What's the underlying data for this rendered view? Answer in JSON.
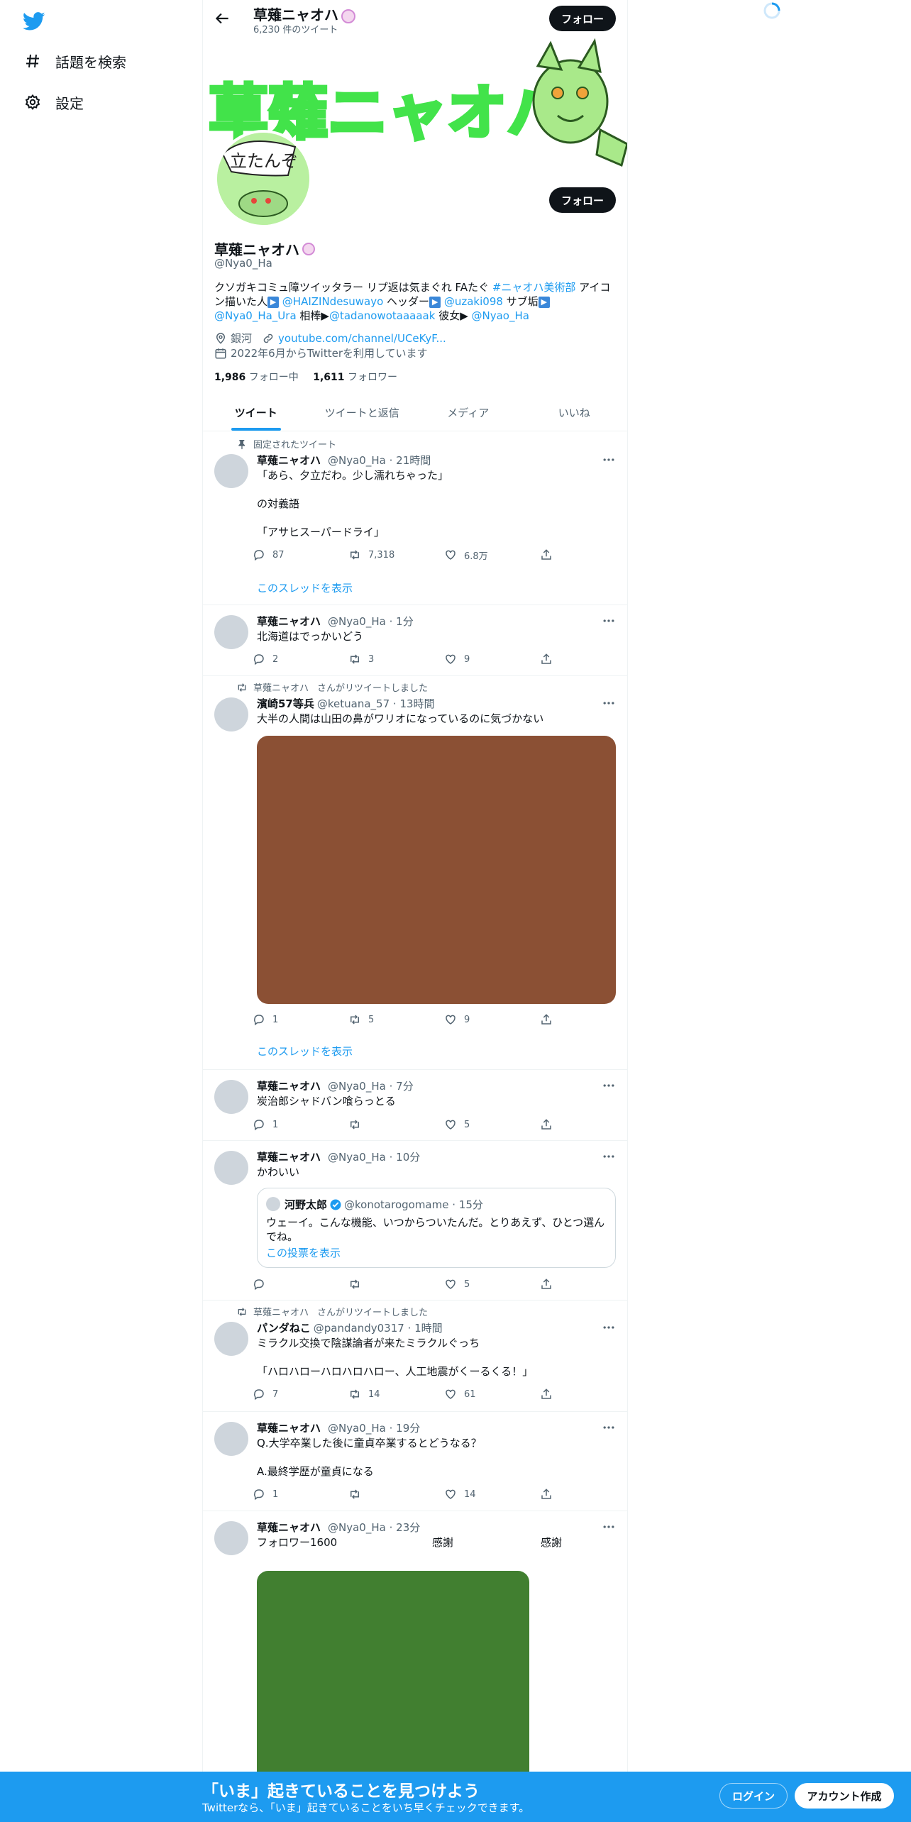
{
  "sidebar": {
    "items": [
      {
        "label": "話題を検索",
        "icon": "hashtag-icon"
      },
      {
        "label": "設定",
        "icon": "gear-icon"
      }
    ]
  },
  "header": {
    "name": "草薙ニャオハ",
    "tweet_count": "6,230 件のツイート",
    "follow_label": "フォロー"
  },
  "banner": {
    "title_art": "草薙ニャオハ",
    "avatar_caption": "立たんぞ"
  },
  "profile": {
    "name": "草薙ニャオハ",
    "handle": "@Nya0_Ha",
    "follow_label": "フォロー",
    "bio_1": "クソガキコミュ障ツイッタラー リプ返は気まぐれ FAたぐ ",
    "bio_tag": "#ニャオハ美術部",
    "bio_2": " アイコン描いた人",
    "bio_m1": "@HAIZINdesuwayo",
    "bio_3": " ヘッダー",
    "bio_m2": "@uzaki098",
    "bio_4": " サブ垢",
    "bio_m3": "@Nya0_Ha_Ura",
    "bio_5": " 相棒▶",
    "bio_m4": "@tadanowotaaaaak",
    "bio_6": " 彼女▶ ",
    "bio_m5": "@Nyao_Ha",
    "location": "銀河",
    "link": "youtube.com/channel/UCeKyF...",
    "joined": "2022年6月からTwitterを利用しています",
    "following_count": "1,986",
    "following_label": "フォロー中",
    "followers_count": "1,611",
    "followers_label": "フォロワー"
  },
  "tabs": [
    "ツイート",
    "ツイートと返信",
    "メディア",
    "いいね"
  ],
  "tweets": [
    {
      "context": "固定されたツイート",
      "name": "草薙ニャオハ",
      "handle": "@Nya0_Ha",
      "time": "· 21時間",
      "text": "「あら、夕立だわ。少し濡れちゃった」\n\nの対義語\n\n「アサヒスーパードライ」",
      "replies": "87",
      "retweets": "7,318",
      "likes": "6.8万",
      "show_thread": "このスレッドを表示"
    },
    {
      "name": "草薙ニャオハ",
      "handle": "@Nya0_Ha",
      "time": "· 1分",
      "text": "北海道はでっかいどう",
      "replies": "2",
      "retweets": "3",
      "likes": "9"
    },
    {
      "context": "草薙ニャオハ",
      "context_suffix": "さんがリツイートしました",
      "name": "濱崎57等兵",
      "handle": "@ketuana_57",
      "time": "· 13時間",
      "text": "大半の人間は山田の鼻がワリオになっているのに気づかない",
      "media_color": "#8b5034",
      "replies": "1",
      "retweets": "5",
      "likes": "9",
      "show_thread": "このスレッドを表示"
    },
    {
      "name": "草薙ニャオハ",
      "handle": "@Nya0_Ha",
      "time": "· 7分",
      "text": "炭治郎シャドバン喰らっとる",
      "replies": "1",
      "retweets": "",
      "likes": "5"
    },
    {
      "name": "草薙ニャオハ",
      "handle": "@Nya0_Ha",
      "time": "· 10分",
      "text": "かわいい",
      "quote": {
        "name": "河野太郎",
        "handle": "@konotarogomame",
        "time": "· 15分",
        "text": "ウェーイ。こんな機能、いつからついたんだ。とりあえず、ひとつ選んでね。",
        "poll_link": "この投票を表示"
      },
      "replies": "",
      "retweets": "",
      "likes": "5"
    },
    {
      "context": "草薙ニャオハ",
      "context_suffix": "さんがリツイートしました",
      "name": "パンダねこ",
      "handle": "@pandandy0317",
      "time": "· 1時間",
      "text": "ミラクル交換で陰謀論者が来たミラクルぐっち\n\n「ハロハローハロハロハロー、人工地震がくーるくる！」",
      "replies": "7",
      "retweets": "14",
      "likes": "61"
    },
    {
      "name": "草薙ニャオハ",
      "handle": "@Nya0_Ha",
      "time": "· 19分",
      "text": "Q.大学卒業した後に童貞卒業するとどうなる？\n\nA.最終学歴が童貞になる",
      "replies": "1",
      "retweets": "",
      "likes": "14"
    },
    {
      "name": "草薙ニャオハ",
      "handle": "@Nya0_Ha",
      "time": "· 23分",
      "text": "フォロワー1600",
      "text_2": "感謝",
      "text_3": "感謝",
      "media_color": "#417f30"
    }
  ],
  "bottom_bar": {
    "title": "「いま」起きていることを見つけよう",
    "subtitle": "Twitterなら、「いま」起きていることをいち早くチェックできます。",
    "login": "ログイン",
    "signup": "アカウント作成"
  },
  "colors": {
    "accent": "#1d9bf0",
    "media_brown": "#8b5034",
    "media_green": "#417f30"
  }
}
